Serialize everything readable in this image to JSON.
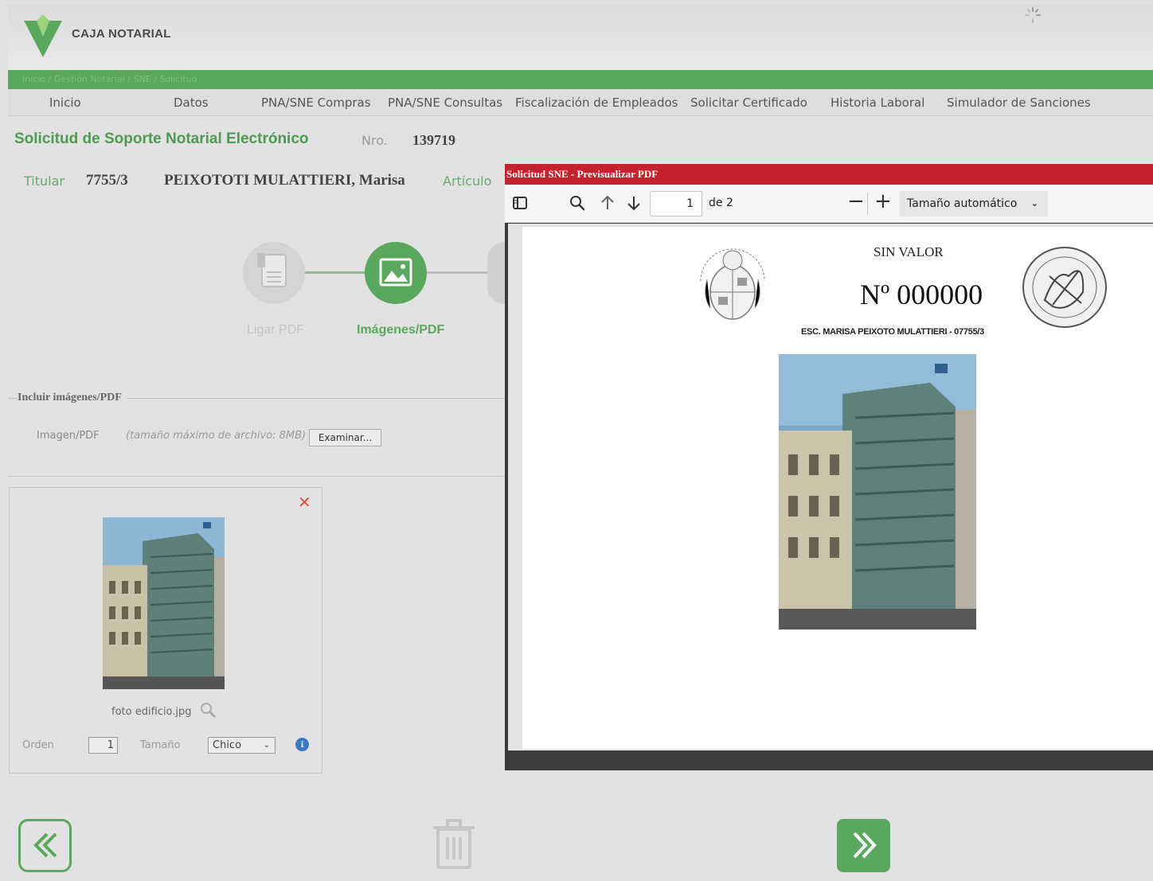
{
  "header": {
    "brand": "CAJA NOTARIAL"
  },
  "breadcrumb": {
    "text": "Inicio / Gestión Notarial / SNE / Solicitud"
  },
  "nav": {
    "items": [
      "Inicio",
      "Datos",
      "PNA/SNE Compras",
      "PNA/SNE Consultas",
      "Fiscalización de Empleados",
      "Solicitar Certificado",
      "Historia Laboral",
      "Simulador de Sanciones"
    ]
  },
  "page": {
    "title": "Solicitud de Soporte Notarial Electrónico",
    "nro_label": "Nro.",
    "nro_value": "139719",
    "titular_label": "Titular",
    "titular_code": "7755/3",
    "titular_name": "PEIXOTOTI MULATTIERI, Marisa",
    "articulo_label": "Artículo"
  },
  "steps": [
    {
      "label": "Ligar PDF",
      "icon": "pdf-file-icon",
      "state": "done"
    },
    {
      "label": "Imágenes/PDF",
      "icon": "image-icon",
      "state": "active"
    }
  ],
  "upload": {
    "legend": "Incluir imágenes/PDF",
    "field_label": "Imagen/PDF",
    "hint": "(tamaño máximo de archivo: 8MB)",
    "browse_label": "Examinar..."
  },
  "image_card": {
    "filename": "foto edificio.jpg",
    "orden_label": "Orden",
    "orden_value": "1",
    "tamano_label": "Tamaño",
    "tamano_value": "Chico"
  },
  "pdf_preview": {
    "dialog_title": "Solicitud SNE - Previsualizar PDF",
    "page_current": "1",
    "page_of": "de 2",
    "zoom_value": "Tamaño automático",
    "doc": {
      "stamp": "SIN VALOR",
      "number": "Nº  000000",
      "escribano": "ESC. MARISA PEIXOTO MULATTIERI - 07755/3"
    }
  },
  "colors": {
    "brand_green": "#5aa85d",
    "dialog_red": "#c4232e",
    "close_red": "#e0503b",
    "info_blue": "#3a78c2"
  }
}
